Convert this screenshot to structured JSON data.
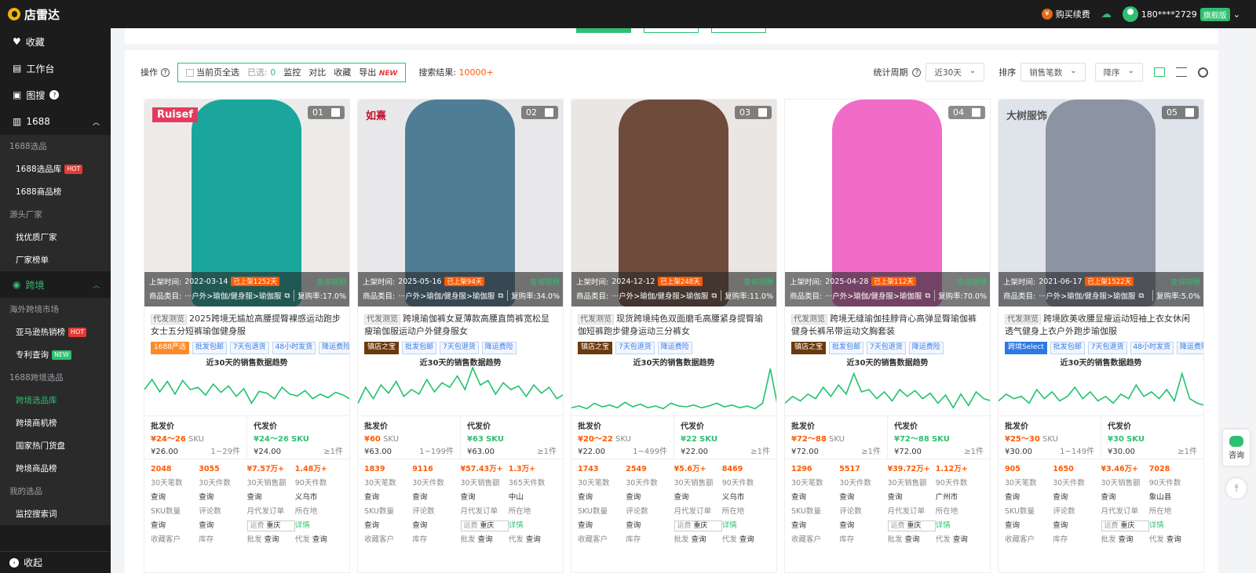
{
  "app": {
    "name": "店雷达"
  },
  "topbar": {
    "buy_label": "购买续费",
    "user": "180****2729",
    "vip": "旗舰版"
  },
  "sidebar": {
    "favorites": "收藏",
    "workbench": "工作台",
    "image_search": "图搜",
    "s1688": "1688",
    "s1688_items": [
      {
        "type": "head",
        "label": "1688选品"
      },
      {
        "type": "link",
        "label": "1688选品库",
        "badge": "HOT"
      },
      {
        "type": "link",
        "label": "1688商品榜"
      },
      {
        "type": "head",
        "label": "源头厂家"
      },
      {
        "type": "link",
        "label": "找优质厂家"
      },
      {
        "type": "link",
        "label": "厂家榜单"
      }
    ],
    "cross": "跨境",
    "cross_items": [
      {
        "type": "head",
        "label": "海外跨境市场"
      },
      {
        "type": "link",
        "label": "亚马逊热销榜",
        "badge": "HOT"
      },
      {
        "type": "link",
        "label": "专利查询",
        "badge": "NEW"
      },
      {
        "type": "head",
        "label": "1688跨境选品"
      },
      {
        "type": "link",
        "label": "跨境选品库",
        "active": true
      },
      {
        "type": "link",
        "label": "跨境商机榜"
      },
      {
        "type": "link",
        "label": "国家热门货盘"
      },
      {
        "type": "link",
        "label": "跨境商品榜"
      },
      {
        "type": "head",
        "label": "我的选品"
      },
      {
        "type": "link",
        "label": "监控搜索词"
      }
    ],
    "collapse": "收起"
  },
  "toolbar": {
    "op_label": "操作",
    "select_page": "当前页全选",
    "selected_label": "已选:",
    "selected_count": "0",
    "monitor": "监控",
    "compare": "对比",
    "favorite": "收藏",
    "export": "导出",
    "export_badge": "NEW",
    "result_label": "搜索结果:",
    "result_count": "10000+",
    "period_label": "统计周期",
    "period_value": "近30天",
    "sort_label": "排序",
    "sort_field": "销售笔数",
    "sort_order": "降序"
  },
  "labels": {
    "listed": "上架时间:",
    "category": "商品类目:",
    "video": "查询视频",
    "repurchase": "复购率:",
    "proxy": "代发测览",
    "trend": "近30天的销售数据趋势",
    "wholesale": "批发价",
    "dropship": "代发价",
    "sku": "SKU",
    "query": "查询",
    "detail": "详情",
    "freight": "运费",
    "wholesale_short": "批发",
    "dropship_short": "代发"
  },
  "products": [
    {
      "idx": "01",
      "brand": "Ruisef",
      "date": "2022-03-14",
      "age": "已上架1252天",
      "category": "···户外>瑜伽/健身服>瑜伽服",
      "rate": "17.0%",
      "title": "2025跨境无尴尬高腰提臀裸感运动跑步女士五分短裤瑜伽健身服",
      "tags": [
        {
          "t": "1688严选",
          "c": "o"
        },
        {
          "t": "批发包邮",
          "c": ""
        },
        {
          "t": "7天包退货",
          "c": ""
        },
        {
          "t": "48小时发货",
          "c": ""
        },
        {
          "t": "降运费险",
          "c": ""
        }
      ],
      "wholesale": "¥24～26",
      "w_price": "¥26.00",
      "w_moq": "1~29件",
      "dropship": "¥24～26",
      "d_price": "¥24.00",
      "d_moq": "≥1件",
      "s": [
        "2048",
        "3055",
        "¥7.57万+",
        "1.48万+"
      ],
      "sl": [
        "30天笔数",
        "30天件数",
        "30天销售额",
        "90天件数"
      ],
      "region": "义乌市",
      "city": "重庆",
      "trend": [
        50,
        72,
        45,
        68,
        40,
        70,
        50,
        55,
        38,
        62,
        44,
        58,
        35,
        52,
        20,
        46,
        42,
        30,
        55,
        40,
        36,
        48,
        30,
        40,
        32,
        44,
        38,
        28
      ]
    },
    {
      "idx": "02",
      "brand": "如熹",
      "date": "2025-05-16",
      "age": "已上架94天",
      "category": "···户外>瑜伽/健身服>瑜伽服",
      "rate": "34.0%",
      "title": "跨境瑜伽裤女夏薄款高腰直筒裤宽松显瘦瑜伽服运动户外健身服女",
      "tags": [
        {
          "t": "镇店之宝",
          "c": "b"
        },
        {
          "t": "批发包邮",
          "c": ""
        },
        {
          "t": "7天包退货",
          "c": ""
        },
        {
          "t": "降运费险",
          "c": ""
        }
      ],
      "wholesale": "¥60",
      "w_price": "¥63.00",
      "w_moq": "1~199件",
      "dropship": "¥63",
      "d_price": "¥63.00",
      "d_moq": "≥1件",
      "s": [
        "1839",
        "9116",
        "¥57.43万+",
        "1.3万+"
      ],
      "sl": [
        "30天笔数",
        "30天件数",
        "30天销售额",
        "365天件数"
      ],
      "region": "中山",
      "city": "重庆",
      "trend": [
        20,
        55,
        30,
        60,
        42,
        68,
        35,
        50,
        40,
        72,
        45,
        65,
        55,
        80,
        50,
        98,
        60,
        70,
        40,
        65,
        50,
        58,
        35,
        60,
        42,
        55,
        30,
        40
      ]
    },
    {
      "idx": "03",
      "brand": "",
      "date": "2024-12-12",
      "age": "已上架248天",
      "category": "···户外>瑜伽/健身服>瑜伽服",
      "rate": "11.0%",
      "title": "现货跨境纯色双面磨毛高腰紧身提臀瑜伽短裤跑步健身运动三分裤女",
      "tags": [
        {
          "t": "镇店之宝",
          "c": "b"
        },
        {
          "t": "7天包退货",
          "c": ""
        },
        {
          "t": "降运费险",
          "c": ""
        }
      ],
      "wholesale": "¥20～22",
      "w_price": "¥22.00",
      "w_moq": "1~499件",
      "dropship": "¥22",
      "d_price": "¥22.00",
      "d_moq": "≥1件",
      "s": [
        "1743",
        "2549",
        "¥5.6万+",
        "8469"
      ],
      "sl": [
        "30天笔数",
        "30天件数",
        "30天销售额",
        "90天件数"
      ],
      "region": "义乌市",
      "city": "重庆",
      "trend": [
        10,
        14,
        8,
        20,
        12,
        16,
        10,
        22,
        12,
        18,
        10,
        14,
        8,
        20,
        14,
        12,
        16,
        10,
        14,
        20,
        12,
        16,
        10,
        14,
        8,
        20,
        96,
        10
      ]
    },
    {
      "idx": "04",
      "brand": "",
      "date": "2025-04-28",
      "age": "已上架112天",
      "category": "···户外>瑜伽/健身服>瑜伽服",
      "rate": "70.0%",
      "title": "跨境无缝瑜伽挂脖背心高弹显臀瑜伽裤健身长裤吊带运动文胸套装",
      "tags": [
        {
          "t": "镇店之宝",
          "c": "b"
        },
        {
          "t": "批发包邮",
          "c": ""
        },
        {
          "t": "7天包退货",
          "c": ""
        },
        {
          "t": "降运费险",
          "c": ""
        }
      ],
      "wholesale": "¥72～88",
      "w_price": "¥72.00",
      "w_moq": "≥1件",
      "dropship": "¥72～88",
      "d_price": "¥72.00",
      "d_moq": "≥1件",
      "s": [
        "1296",
        "5517",
        "¥39.72万+",
        "1.12万+"
      ],
      "sl": [
        "30天笔数",
        "30天件数",
        "30天销售额",
        "90天件数"
      ],
      "region": "广州市",
      "city": "重庆",
      "trend": [
        20,
        35,
        25,
        40,
        30,
        55,
        35,
        60,
        40,
        85,
        45,
        50,
        30,
        45,
        25,
        50,
        35,
        48,
        30,
        42,
        20,
        38,
        10,
        40,
        15,
        45,
        30,
        25
      ]
    },
    {
      "idx": "05",
      "brand": "大树服饰",
      "date": "2021-06-17",
      "age": "已上架1522天",
      "category": "···户外>瑜伽/健身服>瑜伽服",
      "rate": "5.0%",
      "title": "跨境欧美收腰显瘦运动短袖上衣女休闲透气健身上衣户外跑步瑜伽服",
      "tags": [
        {
          "t": "跨境Select",
          "c": "s"
        },
        {
          "t": "批发包邮",
          "c": ""
        },
        {
          "t": "7天包退货",
          "c": ""
        },
        {
          "t": "48小时发货",
          "c": ""
        },
        {
          "t": "降运费险",
          "c": ""
        }
      ],
      "wholesale": "¥25～30",
      "w_price": "¥30.00",
      "w_moq": "1~149件",
      "dropship": "¥30",
      "d_price": "¥30.00",
      "d_moq": "≥1件",
      "s": [
        "905",
        "1650",
        "¥3.46万+",
        "7028"
      ],
      "sl": [
        "30天笔数",
        "30天件数",
        "30天销售额",
        "90天件数"
      ],
      "region": "象山县",
      "city": "重庆",
      "trend": [
        25,
        40,
        30,
        35,
        20,
        50,
        30,
        45,
        25,
        35,
        55,
        30,
        45,
        25,
        35,
        20,
        40,
        30,
        60,
        35,
        45,
        30,
        50,
        25,
        85,
        30,
        20,
        15
      ]
    }
  ],
  "stats2_labels": [
    "SKU数量",
    "评论数",
    "月代发订单",
    "所在地"
  ],
  "stats3_labels": [
    "收藏客户",
    "库存"
  ],
  "float": {
    "help": "咨询"
  }
}
